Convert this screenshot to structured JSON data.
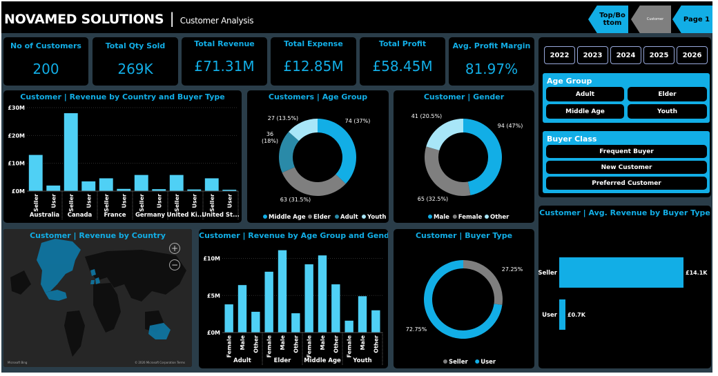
{
  "header": {
    "title": "NOVAMED SOLUTIONS",
    "separator": "|",
    "subtitle": "Customer Analysis"
  },
  "nav": {
    "topbottom_line1": "Top/Bo",
    "topbottom_line2": "ttom",
    "customer": "Customer",
    "page": "Page 1"
  },
  "kpis": [
    {
      "label": "No of Customers",
      "value": "200"
    },
    {
      "label": "Total Qty Sold",
      "value": "269K"
    },
    {
      "label": "Total Revenue",
      "value": "£71.31M"
    },
    {
      "label": "Total Expense",
      "value": "£12.85M"
    },
    {
      "label": "Total Profit",
      "value": "£58.45M"
    },
    {
      "label": "Avg. Profit Margin",
      "value": "81.97%"
    }
  ],
  "years": [
    "2022",
    "2023",
    "2024",
    "2025",
    "2026"
  ],
  "age_group_slicer": {
    "title": "Age Group",
    "items": [
      "Adult",
      "Elder",
      "Middle Age",
      "Youth"
    ]
  },
  "buyer_class_slicer": {
    "title": "Buyer Class",
    "items": [
      "Frequent Buyer",
      "New Customer",
      "Preferred Customer"
    ]
  },
  "map": {
    "title": "Customer | Revenue by Country",
    "footer": "Microsoft Bing",
    "copyright": "© 2026 Microsoft Corporation   Terms"
  },
  "colors": {
    "accent": "#12aee6",
    "bar": "#4fd0f5",
    "grey": "#7f7f7f",
    "light": "#a8e6f8",
    "teal": "#2a8aa8",
    "bg": "#2a3d49",
    "card": "#000000"
  },
  "chart_data": [
    {
      "id": "rev_country_buyer",
      "type": "bar",
      "title": "Customer | Revenue by Country and Buyer Type",
      "ylim": [
        0,
        30
      ],
      "yticks": [
        0,
        10,
        20,
        30
      ],
      "ytick_labels": [
        "£0M",
        "£10M",
        "£20M",
        "£30M"
      ],
      "groups": [
        "Australia",
        "Canada",
        "France",
        "Germany",
        "United Ki...",
        "United St..."
      ],
      "categories": [
        "Seller",
        "User",
        "Seller",
        "User",
        "Seller",
        "User",
        "Seller",
        "User",
        "Seller",
        "User",
        "Seller",
        "User"
      ],
      "values": [
        13,
        2,
        28,
        3.5,
        4.6,
        0.8,
        5.8,
        0.7,
        5.8,
        0.6,
        4.6,
        0.5
      ]
    },
    {
      "id": "age_group",
      "type": "pie",
      "title": "Customers | Age Group",
      "labels": [
        "Middle Age",
        "Elder",
        "Adult",
        "Youth"
      ],
      "values": [
        74,
        63,
        36,
        27
      ],
      "slice_labels": [
        "74 (37%)",
        "63 (31.5%)",
        "36 (18%)",
        "27 (13.5%)"
      ]
    },
    {
      "id": "gender",
      "type": "pie",
      "title": "Customer | Gender",
      "labels": [
        "Male",
        "Female",
        "Other"
      ],
      "values": [
        94,
        65,
        41
      ],
      "slice_labels": [
        "94 (47%)",
        "65 (32.5%)",
        "41 (20.5%)"
      ]
    },
    {
      "id": "rev_age_gender",
      "type": "bar",
      "title": "Customer | Revenue by Age Group and Gender",
      "ylim": [
        0,
        12
      ],
      "yticks": [
        0,
        5,
        10
      ],
      "ytick_labels": [
        "£0M",
        "£5M",
        "£10M"
      ],
      "groups": [
        "Adult",
        "Elder",
        "Middle Age",
        "Youth"
      ],
      "categories": [
        "Female",
        "Male",
        "Other",
        "Female",
        "Male",
        "Other",
        "Female",
        "Male",
        "Other",
        "Female",
        "Male",
        "Other"
      ],
      "values": [
        3.8,
        6.4,
        2.8,
        8.2,
        11.1,
        2.6,
        9.2,
        10.4,
        6.5,
        1.6,
        4.9,
        3
      ]
    },
    {
      "id": "buyer_type",
      "type": "pie",
      "title": "Customer | Buyer Type",
      "labels": [
        "Seller",
        "User"
      ],
      "values": [
        27.25,
        72.75
      ],
      "slice_labels": [
        "27.25%",
        "72.75%"
      ]
    },
    {
      "id": "avg_rev_buyer",
      "type": "bar",
      "title": "Customer | Avg. Revenue by Buyer Type",
      "categories": [
        "Seller",
        "User"
      ],
      "values": [
        14.1,
        0.7
      ],
      "value_labels": [
        "£14.1K",
        "£0.7K"
      ]
    }
  ]
}
